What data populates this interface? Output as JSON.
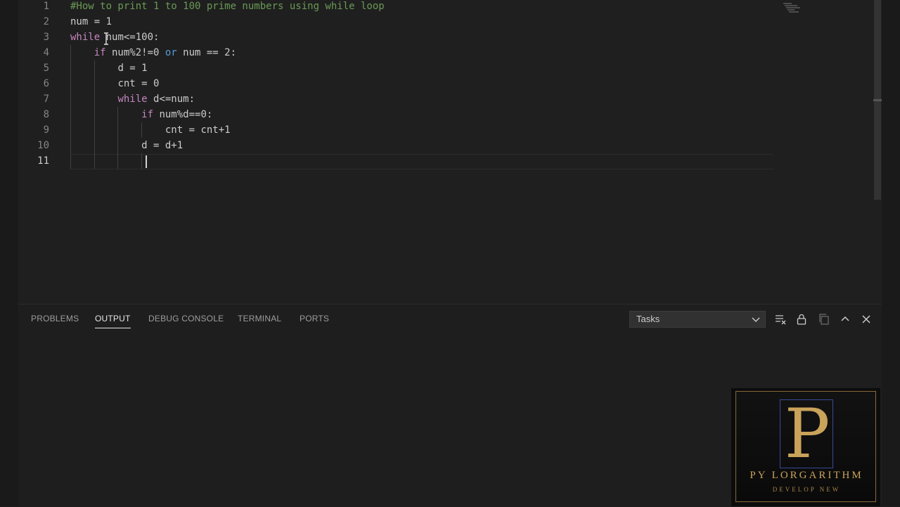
{
  "editor": {
    "lines": [
      {
        "number": "1",
        "indent": 0,
        "tokens": [
          {
            "t": "#How to print 1 to 100 prime numbers using while loop",
            "k": "comment"
          }
        ]
      },
      {
        "number": "2",
        "indent": 0,
        "tokens": [
          {
            "t": "num = 1",
            "k": "plain"
          }
        ]
      },
      {
        "number": "3",
        "indent": 0,
        "tokens": [
          {
            "t": "while",
            "k": "control"
          },
          {
            "t": " num<=100:",
            "k": "plain"
          }
        ]
      },
      {
        "number": "4",
        "indent": 1,
        "tokens": [
          {
            "t": "if",
            "k": "control"
          },
          {
            "t": " num%2!=0 ",
            "k": "plain"
          },
          {
            "t": "or",
            "k": "keyword"
          },
          {
            "t": " num == 2:",
            "k": "plain"
          }
        ]
      },
      {
        "number": "5",
        "indent": 2,
        "tokens": [
          {
            "t": "d = 1",
            "k": "plain"
          }
        ]
      },
      {
        "number": "6",
        "indent": 2,
        "tokens": [
          {
            "t": "cnt = 0",
            "k": "plain"
          }
        ]
      },
      {
        "number": "7",
        "indent": 2,
        "tokens": [
          {
            "t": "while",
            "k": "control"
          },
          {
            "t": " d<=num:",
            "k": "plain"
          }
        ]
      },
      {
        "number": "8",
        "indent": 3,
        "tokens": [
          {
            "t": "if",
            "k": "control"
          },
          {
            "t": " num%d==0:",
            "k": "plain"
          }
        ]
      },
      {
        "number": "9",
        "indent": 4,
        "tokens": [
          {
            "t": "cnt = cnt+1",
            "k": "plain"
          }
        ]
      },
      {
        "number": "10",
        "indent": 3,
        "tokens": [
          {
            "t": "d = d+1",
            "k": "plain"
          }
        ]
      },
      {
        "number": "11",
        "indent": 0,
        "tokens": []
      }
    ],
    "active_line": "11"
  },
  "panel": {
    "tabs": [
      {
        "label": "PROBLEMS",
        "active": false,
        "name": "tab-problems"
      },
      {
        "label": "OUTPUT",
        "active": true,
        "name": "tab-output"
      },
      {
        "label": "DEBUG CONSOLE",
        "active": false,
        "name": "tab-debug-console"
      },
      {
        "label": "TERMINAL",
        "active": false,
        "name": "tab-terminal"
      },
      {
        "label": "PORTS",
        "active": false,
        "name": "tab-ports"
      }
    ],
    "output_channel": "Tasks",
    "actions": [
      {
        "name": "clear-output-icon"
      },
      {
        "name": "lock-scroll-icon"
      },
      {
        "name": "open-editor-icon"
      },
      {
        "name": "maximize-panel-icon"
      },
      {
        "name": "close-panel-icon"
      }
    ]
  },
  "logo": {
    "letter": "P",
    "name": "PY LORGARITHM",
    "tagline": "DEVELOP NEW"
  },
  "colors": {
    "comment": "#6a9955",
    "keyword": "#569cd6",
    "control": "#c586c0",
    "text": "#cccccc",
    "accent_gold": "#c9a35a"
  }
}
